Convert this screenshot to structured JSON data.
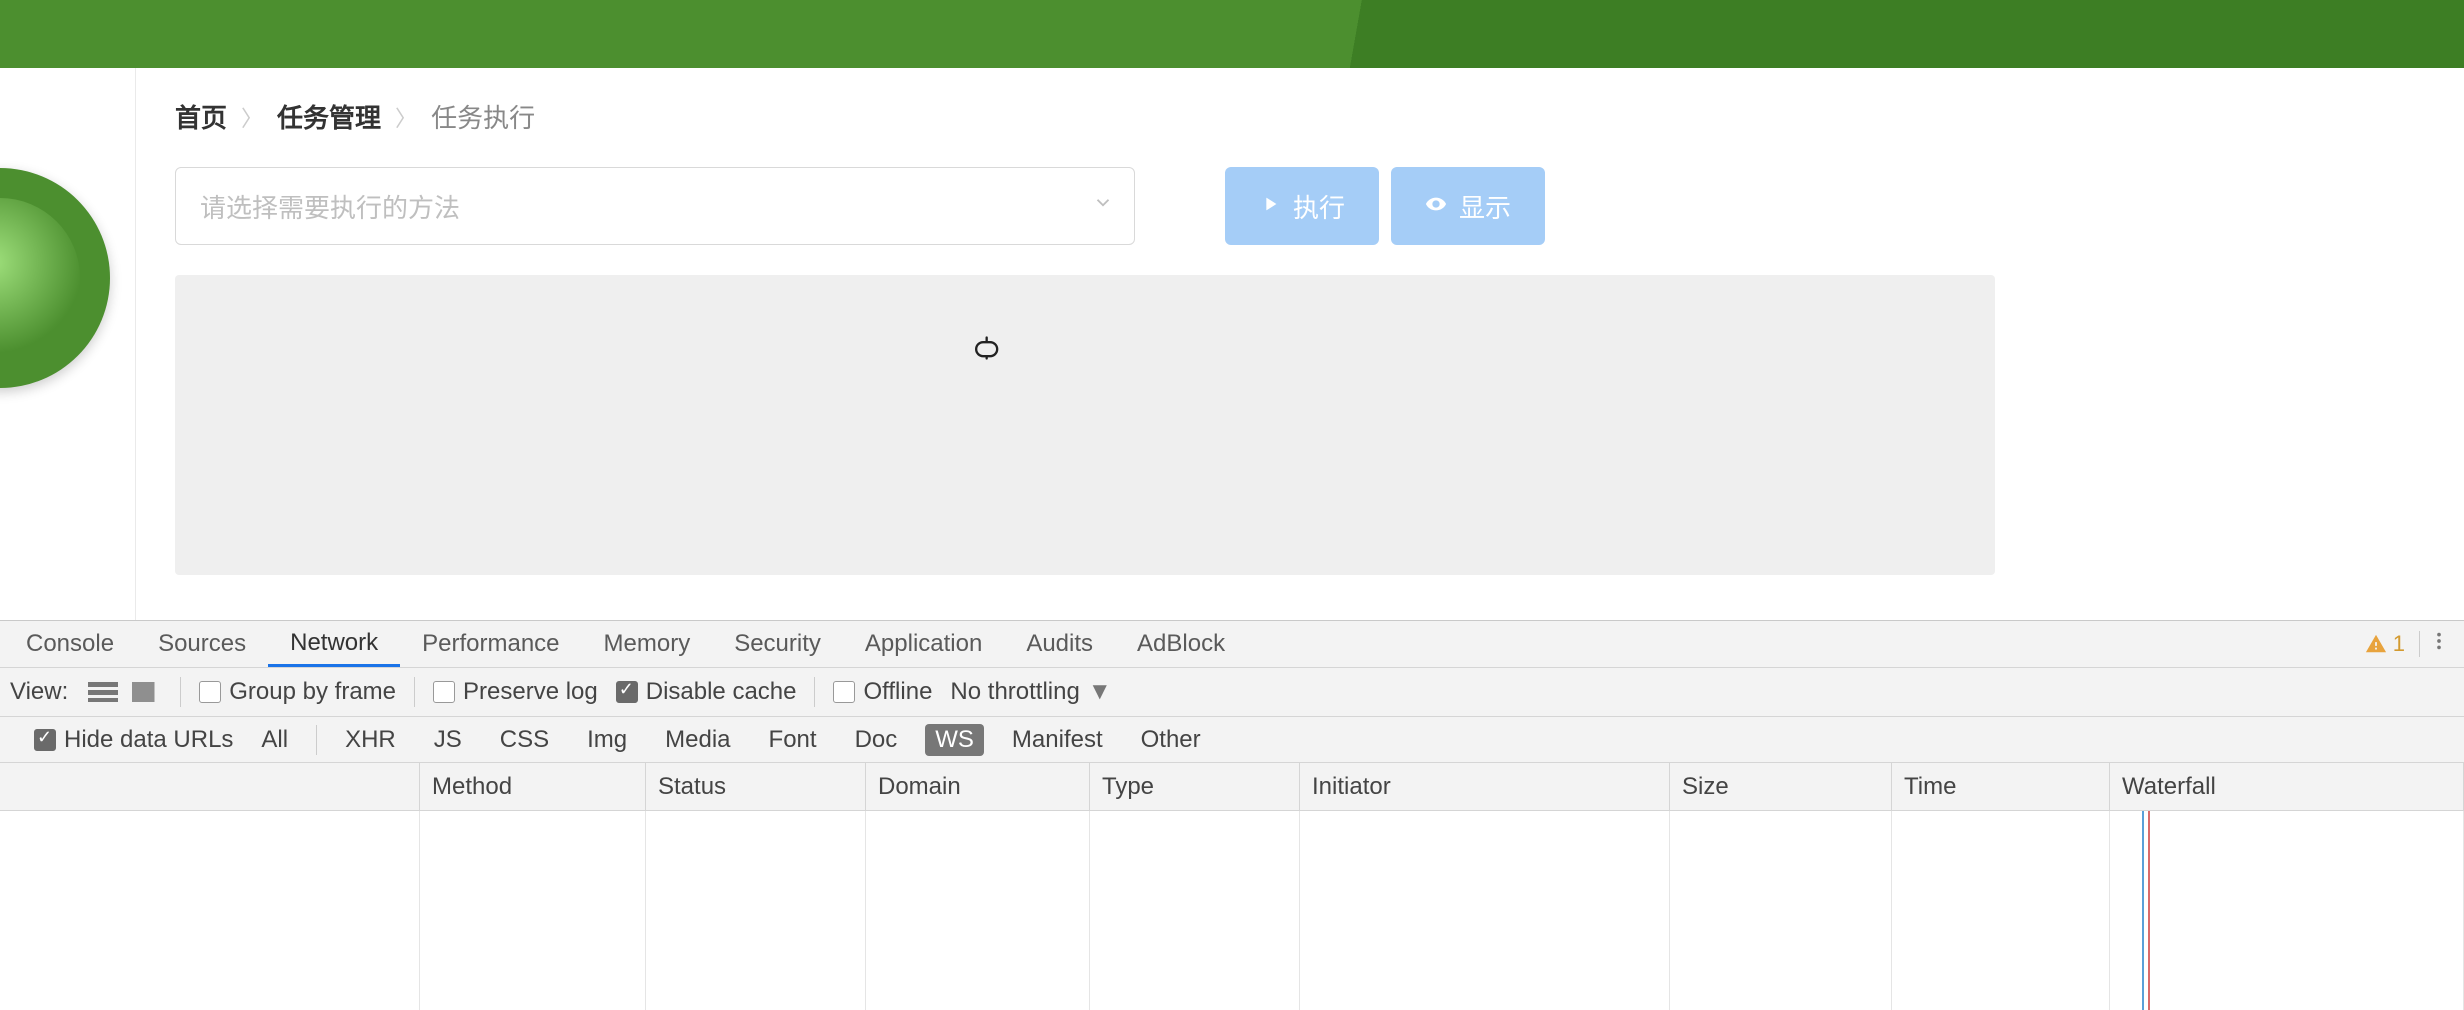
{
  "breadcrumb": {
    "home": "首页",
    "tasks": "任务管理",
    "current": "任务执行"
  },
  "select": {
    "placeholder": "请选择需要执行的方法"
  },
  "buttons": {
    "execute": "执行",
    "show": "显示"
  },
  "devtools": {
    "tabs": {
      "console": "Console",
      "sources": "Sources",
      "network": "Network",
      "performance": "Performance",
      "memory": "Memory",
      "security": "Security",
      "application": "Application",
      "audits": "Audits",
      "adblock": "AdBlock"
    },
    "warnings_count": "1",
    "toolbar": {
      "view_label": "View:",
      "group_by_frame": "Group by frame",
      "preserve_log": "Preserve log",
      "disable_cache": "Disable cache",
      "offline": "Offline",
      "no_throttling": "No throttling"
    },
    "filters": {
      "hide_data_urls": "Hide data URLs",
      "all": "All",
      "xhr": "XHR",
      "js": "JS",
      "css": "CSS",
      "img": "Img",
      "media": "Media",
      "font": "Font",
      "doc": "Doc",
      "ws": "WS",
      "manifest": "Manifest",
      "other": "Other"
    },
    "columns": {
      "name": "",
      "method": "Method",
      "status": "Status",
      "domain": "Domain",
      "type": "Type",
      "initiator": "Initiator",
      "size": "Size",
      "time": "Time",
      "waterfall": "Waterfall"
    }
  }
}
